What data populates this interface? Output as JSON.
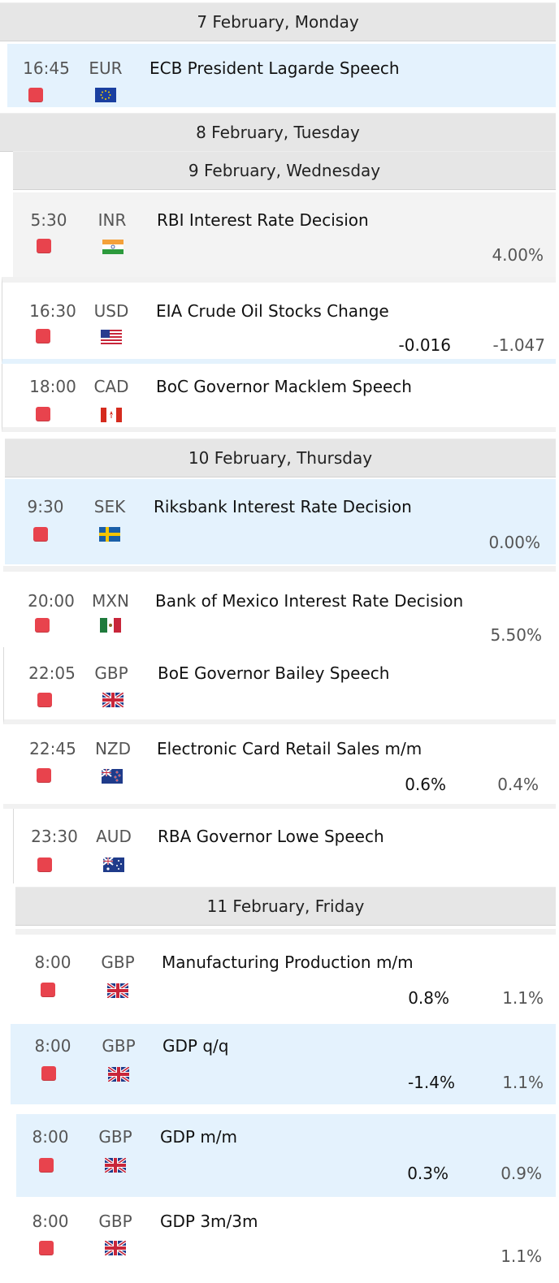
{
  "days": [
    {
      "label": "7 February, Monday"
    },
    {
      "label": "8 February, Tuesday"
    },
    {
      "label": "9 February, Wednesday"
    },
    {
      "label": "10 February, Thursday"
    },
    {
      "label": "11 February, Friday"
    }
  ],
  "events": [
    {
      "time": "16:45",
      "currency": "EUR",
      "title": "ECB President Lagarde Speech",
      "actual": "",
      "forecast": "",
      "importance": "high",
      "flag": "eu-flag-icon"
    },
    {
      "time": "5:30",
      "currency": "INR",
      "title": "RBI Interest Rate Decision",
      "actual": "",
      "forecast": "4.00%",
      "importance": "high",
      "flag": "india-flag-icon"
    },
    {
      "time": "16:30",
      "currency": "USD",
      "title": "EIA Crude Oil Stocks Change",
      "actual": "-0.016",
      "forecast": "-1.047",
      "importance": "high",
      "flag": "usa-flag-icon"
    },
    {
      "time": "18:00",
      "currency": "CAD",
      "title": "BoC Governor Macklem Speech",
      "actual": "",
      "forecast": "",
      "importance": "high",
      "flag": "canada-flag-icon"
    },
    {
      "time": "9:30",
      "currency": "SEK",
      "title": "Riksbank Interest Rate Decision",
      "actual": "",
      "forecast": "0.00%",
      "importance": "high",
      "flag": "sweden-flag-icon"
    },
    {
      "time": "20:00",
      "currency": "MXN",
      "title": "Bank of Mexico Interest Rate Decision",
      "actual": "",
      "forecast": "5.50%",
      "importance": "high",
      "flag": "mexico-flag-icon"
    },
    {
      "time": "22:05",
      "currency": "GBP",
      "title": "BoE Governor Bailey Speech",
      "actual": "",
      "forecast": "",
      "importance": "high",
      "flag": "uk-flag-icon"
    },
    {
      "time": "22:45",
      "currency": "NZD",
      "title": "Electronic Card Retail Sales m/m",
      "actual": "0.6%",
      "forecast": "0.4%",
      "importance": "high",
      "flag": "new-zealand-flag-icon"
    },
    {
      "time": "23:30",
      "currency": "AUD",
      "title": "RBA Governor Lowe Speech",
      "actual": "",
      "forecast": "",
      "importance": "high",
      "flag": "australia-flag-icon"
    },
    {
      "time": "8:00",
      "currency": "GBP",
      "title": "Manufacturing Production m/m",
      "actual": "0.8%",
      "forecast": "1.1%",
      "importance": "high",
      "flag": "uk-flag-icon"
    },
    {
      "time": "8:00",
      "currency": "GBP",
      "title": "GDP q/q",
      "actual": "-1.4%",
      "forecast": "1.1%",
      "importance": "high",
      "flag": "uk-flag-icon"
    },
    {
      "time": "8:00",
      "currency": "GBP",
      "title": "GDP m/m",
      "actual": "0.3%",
      "forecast": "0.9%",
      "importance": "high",
      "flag": "uk-flag-icon"
    },
    {
      "time": "8:00",
      "currency": "GBP",
      "title": "GDP 3m/3m",
      "actual": "",
      "forecast": "1.1%",
      "importance": "high",
      "flag": "uk-flag-icon"
    }
  ],
  "colors": {
    "importance_high": "#e8434d",
    "highlight_row": "#e4f2fd",
    "day_header": "#e6e6e6"
  }
}
